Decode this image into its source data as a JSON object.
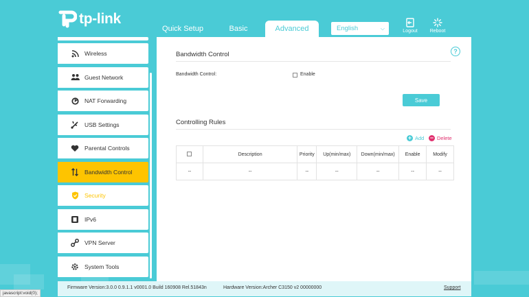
{
  "brand": {
    "name": "tp-link"
  },
  "topnav": {
    "quick_setup": "Quick Setup",
    "basic": "Basic",
    "advanced": "Advanced"
  },
  "language": {
    "selected": "English"
  },
  "actions": {
    "logout": "Logout",
    "reboot": "Reboot"
  },
  "sidebar": {
    "items": [
      {
        "label": "Wireless",
        "icon": "wifi-icon"
      },
      {
        "label": "Guest Network",
        "icon": "guest-icon"
      },
      {
        "label": "NAT Forwarding",
        "icon": "nat-icon"
      },
      {
        "label": "USB Settings",
        "icon": "usb-icon"
      },
      {
        "label": "Parental Controls",
        "icon": "heart-icon"
      },
      {
        "label": "Bandwidth Control",
        "icon": "updown-arrows-icon"
      },
      {
        "label": "Security",
        "icon": "shield-icon"
      },
      {
        "label": "IPv6",
        "icon": "ipv6-icon"
      },
      {
        "label": "VPN Server",
        "icon": "vpn-icon"
      },
      {
        "label": "System Tools",
        "icon": "gear-icon"
      }
    ],
    "active": "Bandwidth Control"
  },
  "bandwidth": {
    "title": "Bandwidth Control",
    "field_label": "Bandwidth Control:",
    "enable_label": "Enable",
    "save": "Save"
  },
  "rules": {
    "title": "Controlling Rules",
    "add": "Add",
    "delete": "Delete",
    "columns": [
      "Description",
      "Priority",
      "Up(min/max)",
      "Down(min/max)",
      "Enable",
      "Modify"
    ],
    "row": [
      "--",
      "--",
      "--",
      "--",
      "--",
      "--",
      "--"
    ]
  },
  "footer": {
    "firmware": "Firmware Version:3.0.0 0.9.1.1 v0001.0 Build 160908 Rel.51843n",
    "hardware": "Hardware Version:Archer C3150 v2 00000000",
    "support": "Support"
  },
  "statusbar": "javascript:void(0);",
  "colors": {
    "accent": "#4acbd6",
    "active": "#fec400",
    "delete": "#e0306e"
  }
}
